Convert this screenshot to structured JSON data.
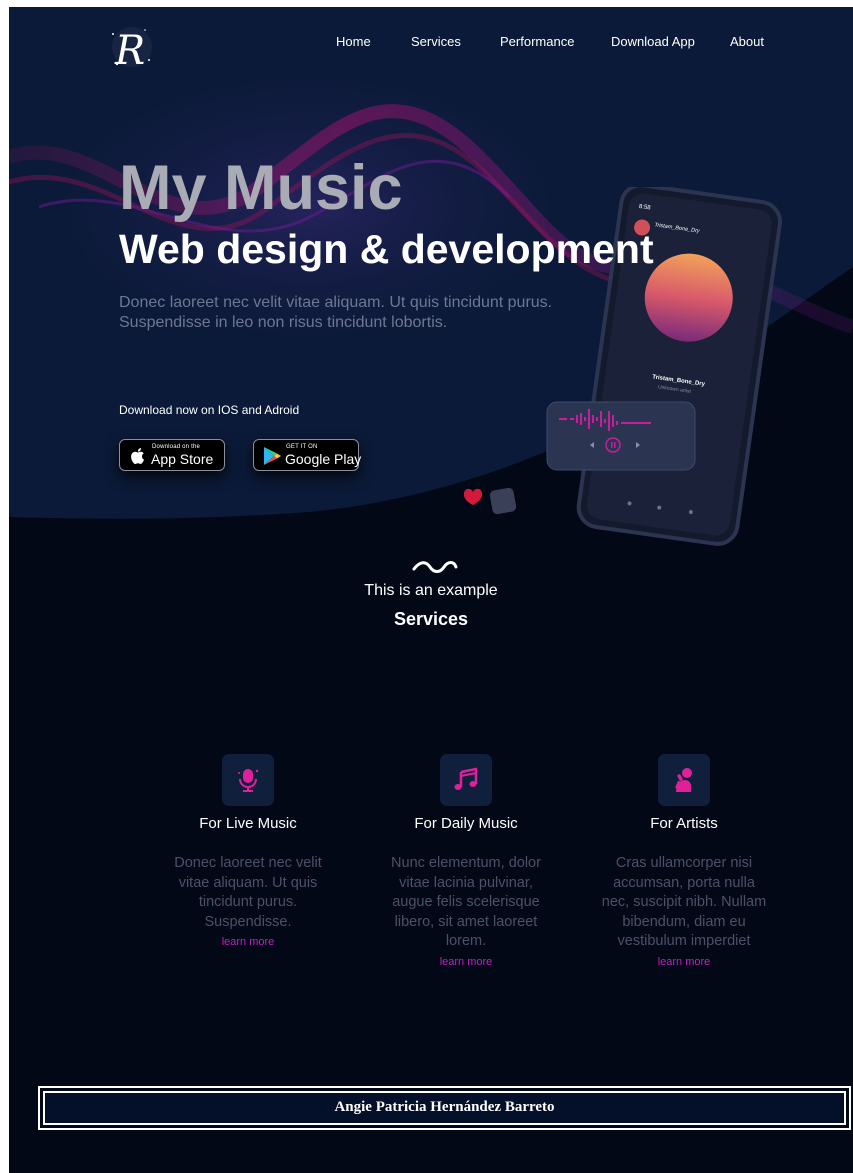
{
  "nav": {
    "logo_letter": "R",
    "links": [
      "Home",
      "Services",
      "Performance",
      "Download App",
      "About"
    ]
  },
  "hero": {
    "title": "My Music",
    "subtitle": "Web design & development",
    "description": "Donec laoreet nec velit vitae aliquam. Ut quis tincidunt purus. Suspendisse in leo non risus tincidunt lobortis.",
    "download_label": "Download now on IOS and Adroid",
    "app_store": {
      "small": "Download on the",
      "big": "App Store",
      "icon": "apple-icon"
    },
    "google_play": {
      "small": "GET IT ON",
      "big": "Google Play",
      "icon": "google-play-icon"
    },
    "phone": {
      "time": "8:58",
      "track_title": "Tristam_Bone_Dry",
      "artist": "Unknown artist"
    }
  },
  "services": {
    "eyebrow": "This is an example",
    "title": "Services",
    "cards": [
      {
        "title": "For Live Music",
        "text": "Donec laoreet nec velit vitae aliquam. Ut quis tincidunt purus. Suspendisse.",
        "link": "learn more",
        "icon": "microphone-icon"
      },
      {
        "title": "For Daily Music",
        "text": "Nunc elementum, dolor vitae lacinia pulvinar, augue felis scelerisque libero, sit amet laoreet lorem.",
        "link": "learn more",
        "icon": "music-note-icon"
      },
      {
        "title": "For Artists",
        "text": "Cras ullamcorper nisi accumsan, porta nulla nec, suscipit nibh. Nullam bibendum, diam eu vestibulum imperdiet",
        "link": "learn more",
        "icon": "singer-icon"
      }
    ]
  },
  "footer": {
    "name": "Angie Patricia Hernández Barreto"
  },
  "colors": {
    "background": "#030817",
    "hero_background": "#0b1a38",
    "accent_magenta": "#c41ec8",
    "muted_text": "#4a5268"
  }
}
